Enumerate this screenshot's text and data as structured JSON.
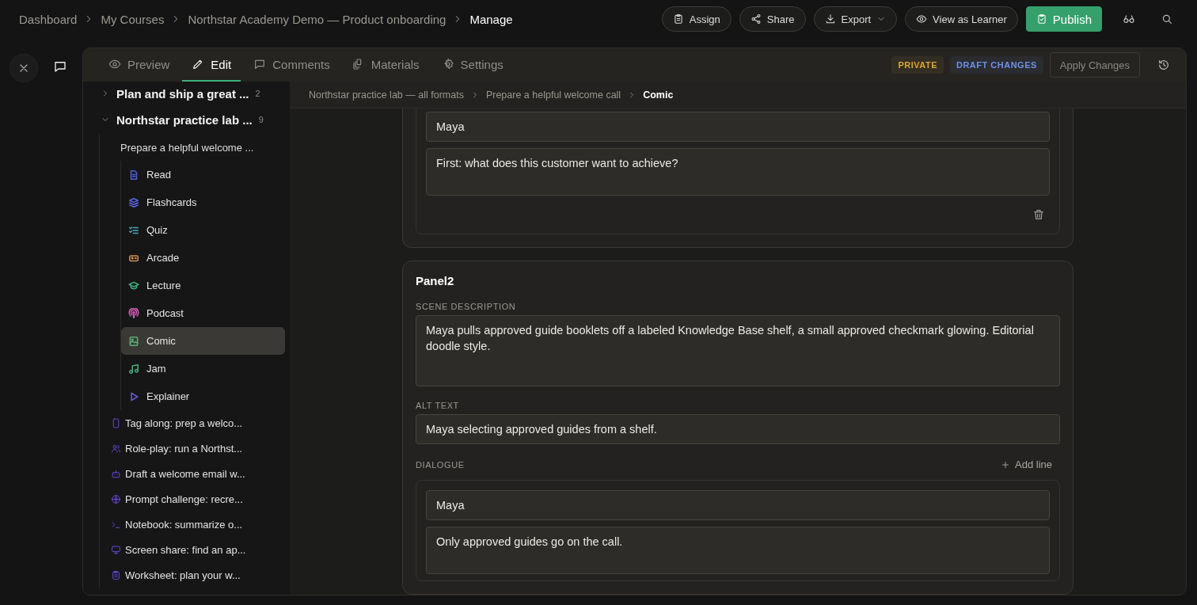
{
  "top_bar": {
    "breadcrumb": [
      {
        "label": "Dashboard",
        "current": false
      },
      {
        "label": "My Courses",
        "current": false
      },
      {
        "label": "Northstar Academy Demo — Product onboarding",
        "current": false
      },
      {
        "label": "Manage",
        "current": true
      }
    ],
    "buttons": [
      {
        "kind": "assign",
        "label": "Assign"
      },
      {
        "kind": "share",
        "label": "Share"
      },
      {
        "kind": "export",
        "label": "Export"
      },
      {
        "kind": "view",
        "label": "View as Learner"
      },
      {
        "kind": "publish",
        "label": "Publish"
      }
    ]
  },
  "tabs": [
    {
      "kind": "preview",
      "label": "Preview",
      "selected": false
    },
    {
      "kind": "edit",
      "label": "Edit",
      "selected": true
    },
    {
      "kind": "comments",
      "label": "Comments",
      "selected": false
    },
    {
      "kind": "materials",
      "label": "Materials",
      "selected": false
    },
    {
      "kind": "settings",
      "label": "Settings",
      "selected": false
    }
  ],
  "badges": [
    {
      "label": "PRIVATE",
      "color": "#d9a43a"
    },
    {
      "label": "DRAFT CHANGES",
      "color": "#6f90e6"
    }
  ],
  "apply_button": {
    "label": "Apply Changes",
    "disabled": true
  },
  "sidebar": {
    "items": [
      {
        "label": "Plan and ship a great ...",
        "count": "2",
        "expanded": false
      },
      {
        "label": "Northstar practice lab ...",
        "count": "9",
        "expanded": true,
        "children": [
          {
            "label": "Prepare a helpful welcome ...",
            "children": [
              {
                "kind": "read",
                "label": "Read",
                "color": "#4d5fd8",
                "selected": false
              },
              {
                "kind": "flashcards",
                "label": "Flashcards",
                "color": "#5b6ae6",
                "selected": false
              },
              {
                "kind": "quiz",
                "label": "Quiz",
                "color": "#4aa3b5",
                "selected": false
              },
              {
                "kind": "arcade",
                "label": "Arcade",
                "color": "#d18a4c",
                "selected": false
              },
              {
                "kind": "lecture",
                "label": "Lecture",
                "color": "#3fae7e",
                "selected": false
              },
              {
                "kind": "podcast",
                "label": "Podcast",
                "color": "#d25cb3",
                "selected": false
              },
              {
                "kind": "comic",
                "label": "Comic",
                "color": "#5aae74",
                "selected": true
              },
              {
                "kind": "jam",
                "label": "Jam",
                "color": "#3fae7e",
                "selected": false
              },
              {
                "kind": "explainer",
                "label": "Explainer",
                "color": "#6a5ae6",
                "selected": false
              }
            ]
          },
          {
            "kind": "phone",
            "label": "Tag along: prep a welco..."
          },
          {
            "kind": "people",
            "label": "Role-play: run a Northst..."
          },
          {
            "kind": "bot",
            "label": "Draft a welcome email w..."
          },
          {
            "kind": "globe",
            "label": "Prompt challenge: recre..."
          },
          {
            "kind": "terminal",
            "label": "Notebook: summarize o..."
          },
          {
            "kind": "monitor",
            "label": "Screen share: find an ap..."
          },
          {
            "kind": "clipboard",
            "label": "Worksheet: plan your w..."
          }
        ]
      }
    ]
  },
  "content_breadcrumb": [
    {
      "label": "Northstar practice lab — all formats",
      "current": false
    },
    {
      "label": "Prepare a helpful welcome call",
      "current": false
    },
    {
      "label": "Comic",
      "current": true
    }
  ],
  "panels": [
    {
      "dialogue": [
        {
          "speaker": "Maya",
          "line": "First: what does this customer want to achieve?"
        }
      ]
    },
    {
      "title": "Panel2",
      "fields": [
        {
          "kind": "textarea",
          "label": "SCENE DESCRIPTION",
          "value": "Maya pulls approved guide booklets off a labeled Knowledge Base shelf, a small approved checkmark glowing. Editorial doodle style."
        },
        {
          "kind": "input",
          "label": "ALT TEXT",
          "value": "Maya selecting approved guides from a shelf."
        }
      ],
      "dialogue_label": "DIALOGUE",
      "add_line": "Add line",
      "dialogue": [
        {
          "speaker": "Maya",
          "line": "Only approved guides go on the call."
        }
      ]
    }
  ]
}
